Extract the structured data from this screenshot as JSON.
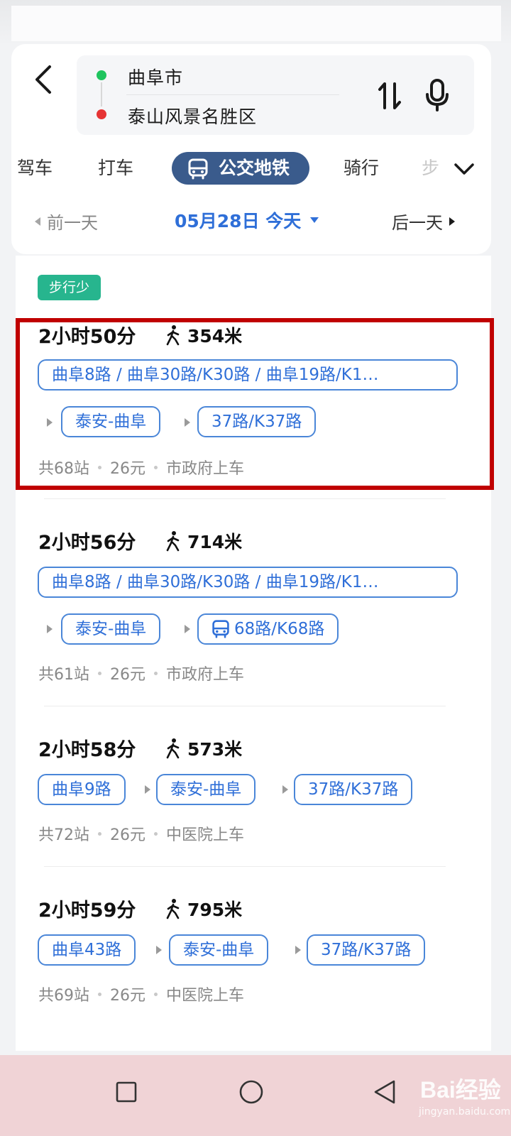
{
  "search": {
    "from": "曲阜市",
    "to": "泰山风景名胜区"
  },
  "tabs": [
    {
      "label": "驾车"
    },
    {
      "label": "打车"
    },
    {
      "label": "公交地铁"
    },
    {
      "label": "骑行"
    },
    {
      "label": "步"
    }
  ],
  "active_tab": "公交地铁",
  "date": {
    "prev": "前一天",
    "current": "05月28日 今天",
    "next": "后一天"
  },
  "badge": "步行少",
  "routes": [
    {
      "time": "2小时50分",
      "walk": "354米",
      "lines_row1": "曲阜8路 / 曲阜30路/K30路 / 曲阜19路/K1…",
      "lines_row2": [
        "泰安-曲阜",
        "37路/K37路"
      ],
      "stops": "共68站",
      "fare": "26元",
      "board": "市政府上车"
    },
    {
      "time": "2小时56分",
      "walk": "714米",
      "lines_row1": "曲阜8路 / 曲阜30路/K30路 / 曲阜19路/K1…",
      "lines_row2": [
        "泰安-曲阜",
        "68路/K68路"
      ],
      "stops": "共61站",
      "fare": "26元",
      "board": "市政府上车"
    },
    {
      "time": "2小时58分",
      "walk": "573米",
      "lines": [
        "曲阜9路",
        "泰安-曲阜",
        "37路/K37路"
      ],
      "stops": "共72站",
      "fare": "26元",
      "board": "中医院上车"
    },
    {
      "time": "2小时59分",
      "walk": "795米",
      "lines": [
        "曲阜43路",
        "泰安-曲阜",
        "37路/K37路"
      ],
      "stops": "共69站",
      "fare": "26元",
      "board": "中医院上车"
    }
  ],
  "watermark": {
    "logo": "Bai经验",
    "url": "jingyan.baidu.com"
  },
  "colors": {
    "accent": "#2f6fd8",
    "active_tab": "#3a5b8c",
    "badge": "#27b58e",
    "highlight": "#c00000",
    "nav_bar": "#f0d3d6"
  }
}
